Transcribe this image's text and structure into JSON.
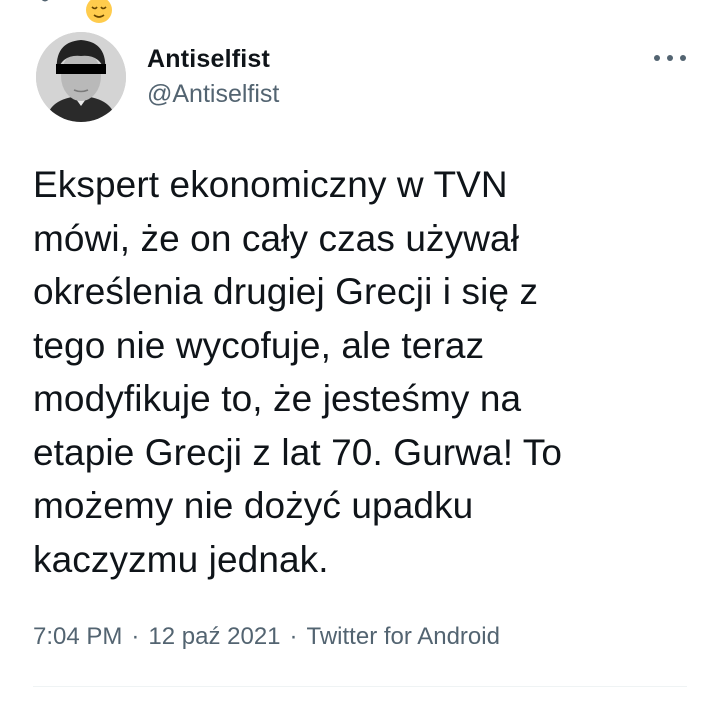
{
  "top_bar": {
    "icons": [
      "pin-icon",
      "relieved-face-emoji"
    ]
  },
  "tweet": {
    "author": {
      "display_name": "Antiselfist",
      "handle": "@Antiselfist"
    },
    "more_icon": "more-horizontal-icon",
    "text": "Ekspert ekonomiczny w TVN\nmówi, że on cały czas używał\nokreślenia drugiej Grecji i się z\ntego nie wycofuje, ale teraz\nmodyfikuje to, że jesteśmy na\netapie Grecji z lat 70. Gurwa! To\nmożemy nie dożyć upadku\nkaczyzmu jednak.",
    "time": "7:04 PM",
    "date": "12 paź 2021",
    "separator": "·",
    "source": "Twitter for Android"
  },
  "colors": {
    "text_primary": "#0f1419",
    "text_secondary": "#536471",
    "divider": "#eff3f4"
  }
}
